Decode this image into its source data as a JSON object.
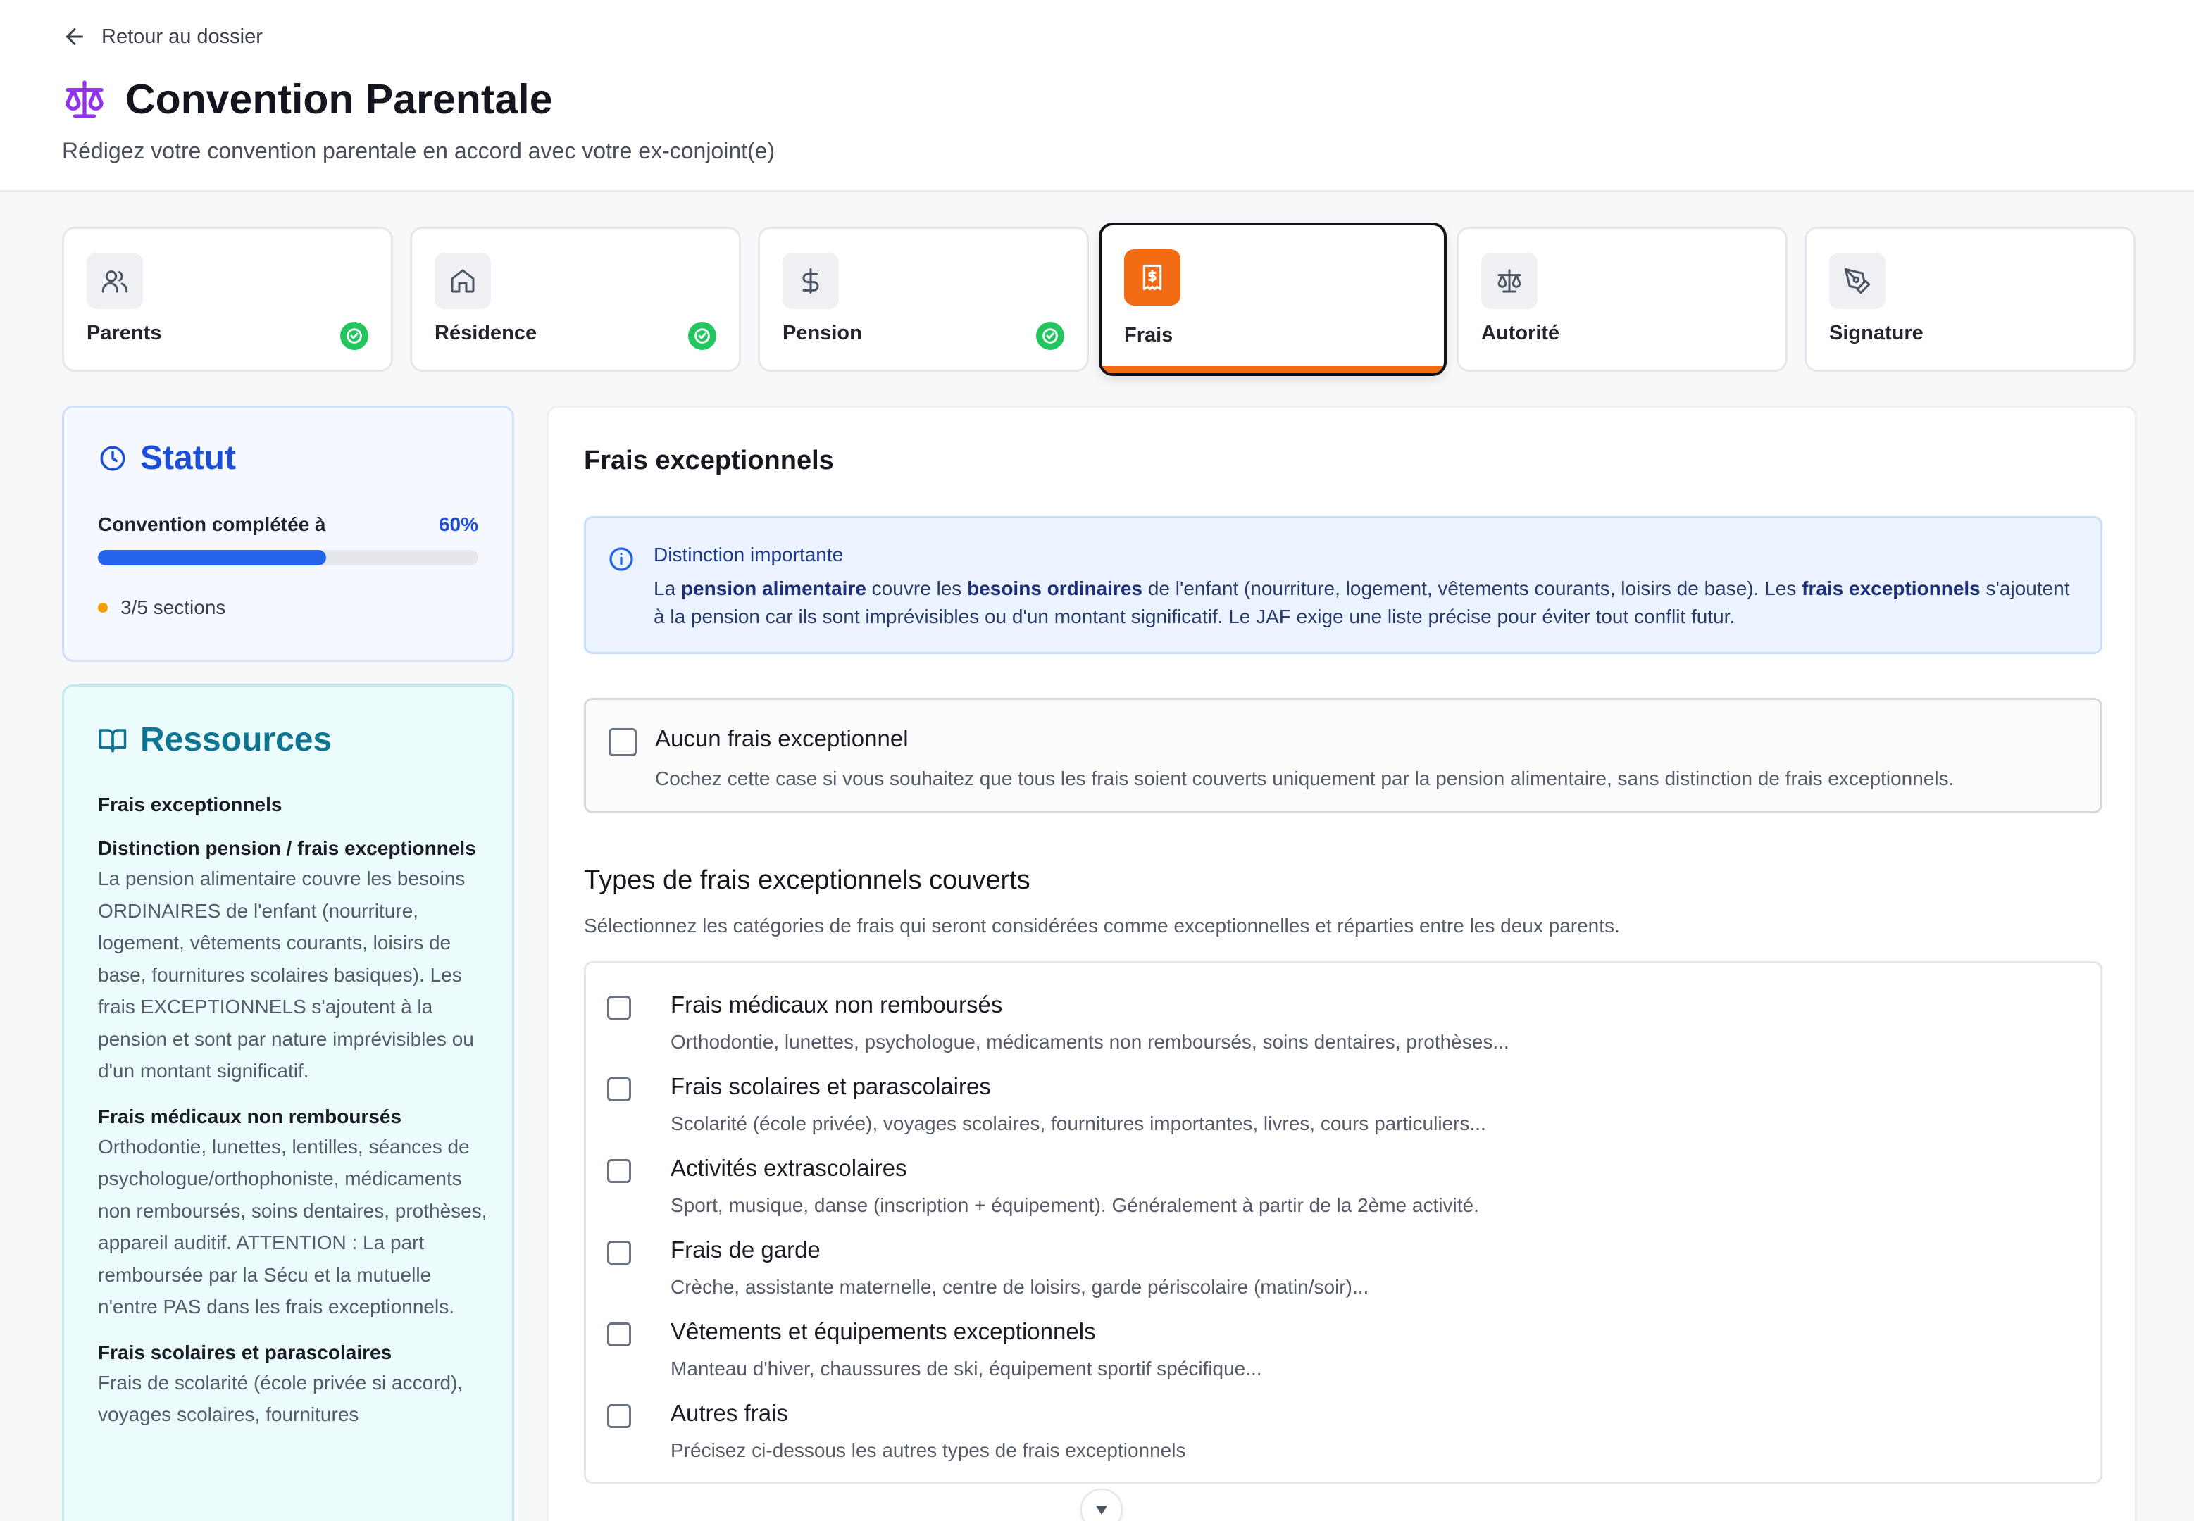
{
  "header": {
    "back_label": "Retour au dossier",
    "title": "Convention Parentale",
    "subtitle": "Rédigez votre convention parentale en accord avec votre ex-conjoint(e)"
  },
  "steps": [
    {
      "label": "Parents",
      "icon": "users-icon",
      "completed": true,
      "active": false
    },
    {
      "label": "Résidence",
      "icon": "home-icon",
      "completed": true,
      "active": false
    },
    {
      "label": "Pension",
      "icon": "dollar-icon",
      "completed": true,
      "active": false
    },
    {
      "label": "Frais",
      "icon": "receipt-icon",
      "completed": false,
      "active": true
    },
    {
      "label": "Autorité",
      "icon": "scale-icon",
      "completed": false,
      "active": false
    },
    {
      "label": "Signature",
      "icon": "pen-tool-icon",
      "completed": false,
      "active": false
    }
  ],
  "statut": {
    "title": "Statut",
    "progress_label": "Convention complétée à",
    "progress_text": "60%",
    "progress_value": 0.6,
    "sections_text": "3/5 sections"
  },
  "ressources": {
    "title": "Ressources",
    "section_title": "Frais exceptionnels",
    "items": [
      {
        "heading": "Distinction pension / frais exceptionnels",
        "text": "La pension alimentaire couvre les besoins ORDINAIRES de l'enfant (nourriture, logement, vêtements courants, loisirs de base, fournitures scolaires basiques). Les frais EXCEPTIONNELS s'ajoutent à la pension et sont par nature imprévisibles ou d'un montant significatif."
      },
      {
        "heading": "Frais médicaux non remboursés",
        "text": "Orthodontie, lunettes, lentilles, séances de psychologue/orthophoniste, médicaments non remboursés, soins dentaires, prothèses, appareil auditif. ATTENTION : La part remboursée par la Sécu et la mutuelle n'entre PAS dans les frais exceptionnels."
      },
      {
        "heading": "Frais scolaires et parascolaires",
        "text": "Frais de scolarité (école privée si accord), voyages scolaires, fournitures"
      }
    ]
  },
  "main": {
    "title": "Frais exceptionnels",
    "info": {
      "title": "Distinction importante",
      "parts": [
        {
          "text": "La ",
          "bold": false
        },
        {
          "text": "pension alimentaire",
          "bold": true
        },
        {
          "text": " couvre les ",
          "bold": false
        },
        {
          "text": "besoins ordinaires",
          "bold": true
        },
        {
          "text": " de l'enfant (nourriture, logement, vêtements courants, loisirs de base). Les ",
          "bold": false
        },
        {
          "text": "frais exceptionnels",
          "bold": true
        },
        {
          "text": " s'ajoutent à la pension car ils sont imprévisibles ou d'un montant significatif. Le JAF exige une liste précise pour éviter tout conflit futur.",
          "bold": false
        }
      ]
    },
    "none_option": {
      "label": "Aucun frais exceptionnel",
      "description": "Cochez cette case si vous souhaitez que tous les frais soient couverts uniquement par la pension alimentaire, sans distinction de frais exceptionnels."
    },
    "types_title": "Types de frais exceptionnels couverts",
    "types_description": "Sélectionnez les catégories de frais qui seront considérées comme exceptionnelles et réparties entre les deux parents.",
    "types": [
      {
        "label": "Frais médicaux non remboursés",
        "description": "Orthodontie, lunettes, psychologue, médicaments non remboursés, soins dentaires, prothèses..."
      },
      {
        "label": "Frais scolaires et parascolaires",
        "description": "Scolarité (école privée), voyages scolaires, fournitures importantes, livres, cours particuliers..."
      },
      {
        "label": "Activités extrascolaires",
        "description": "Sport, musique, danse (inscription + équipement). Généralement à partir de la 2ème activité."
      },
      {
        "label": "Frais de garde",
        "description": "Crèche, assistante maternelle, centre de loisirs, garde périscolaire (matin/soir)..."
      },
      {
        "label": "Vêtements et équipements exceptionnels",
        "description": "Manteau d'hiver, chaussures de ski, équipement sportif spécifique..."
      },
      {
        "label": "Autres frais",
        "description": "Précisez ci-dessous les autres types de frais exceptionnels"
      }
    ]
  },
  "colors": {
    "accent_orange": "#f26b13",
    "success_green": "#22c55e",
    "primary_blue": "#1d4ed8",
    "teal": "#0e7490",
    "title_icon_purple": "#9333ea"
  }
}
